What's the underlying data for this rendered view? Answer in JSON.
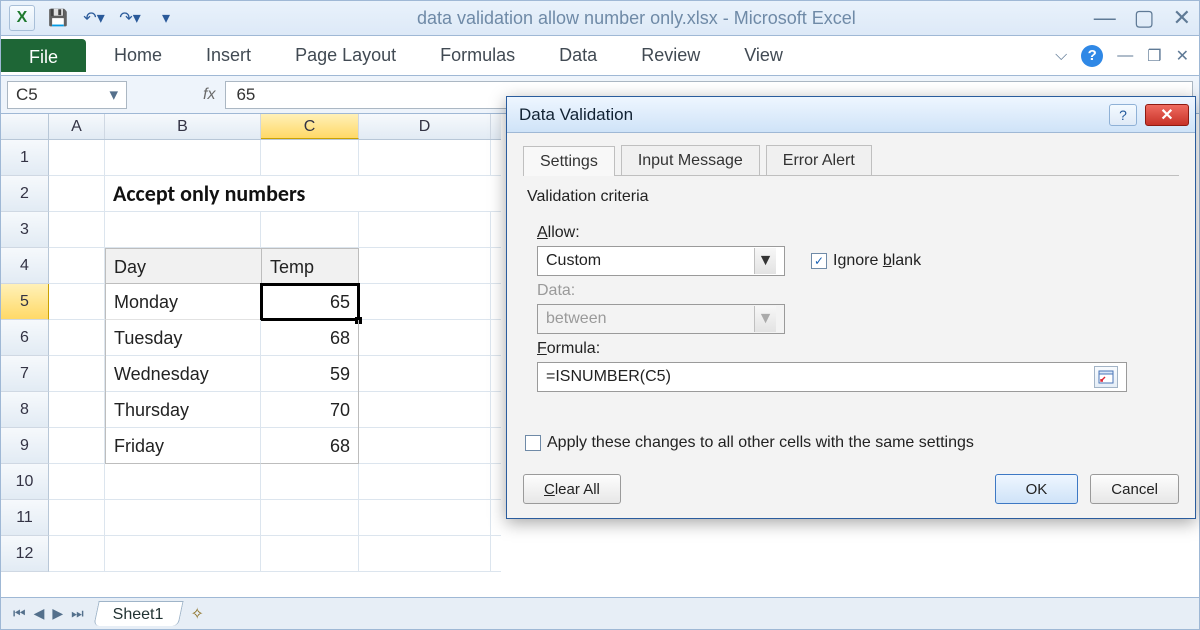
{
  "app": {
    "title": "data validation allow number only.xlsx  -  Microsoft Excel",
    "qat_icons": [
      "excel-logo",
      "save-icon",
      "undo-icon",
      "redo-icon",
      "arrow-icon"
    ]
  },
  "ribbon": {
    "file": "File",
    "tabs": [
      "Home",
      "Insert",
      "Page Layout",
      "Formulas",
      "Data",
      "Review",
      "View"
    ]
  },
  "namebox": {
    "value": "C5"
  },
  "formulabar": {
    "fx": "fx",
    "value": "65"
  },
  "grid": {
    "columns": [
      "A",
      "B",
      "C",
      "D"
    ],
    "rows": [
      "1",
      "2",
      "3",
      "4",
      "5",
      "6",
      "7",
      "8",
      "9",
      "10",
      "11",
      "12"
    ],
    "selected_row": "5",
    "selected_col": "C",
    "title": "Accept only numbers",
    "headers": {
      "b": "Day",
      "c": "Temp"
    },
    "data": [
      {
        "day": "Monday",
        "temp": "65"
      },
      {
        "day": "Tuesday",
        "temp": "68"
      },
      {
        "day": "Wednesday",
        "temp": "59"
      },
      {
        "day": "Thursday",
        "temp": "70"
      },
      {
        "day": "Friday",
        "temp": "68"
      }
    ]
  },
  "sheet_tabs": {
    "active": "Sheet1"
  },
  "dialog": {
    "title": "Data Validation",
    "tabs": [
      "Settings",
      "Input Message",
      "Error Alert"
    ],
    "active_tab": "Settings",
    "criteria_label": "Validation criteria",
    "allow_label": "Allow:",
    "allow_letter": "A",
    "allow_value": "Custom",
    "ignore_blank_label": "Ignore blank",
    "ignore_blank_letter": "b",
    "ignore_blank": true,
    "data_label": "Data:",
    "data_value": "between",
    "formula_label": "Formula:",
    "formula_letter": "F",
    "formula_value": "=ISNUMBER(C5)",
    "apply_label": "Apply these changes to all other cells with the same settings",
    "apply_checked": false,
    "clear_all": "Clear All",
    "clear_letter": "C",
    "ok": "OK",
    "cancel": "Cancel"
  }
}
